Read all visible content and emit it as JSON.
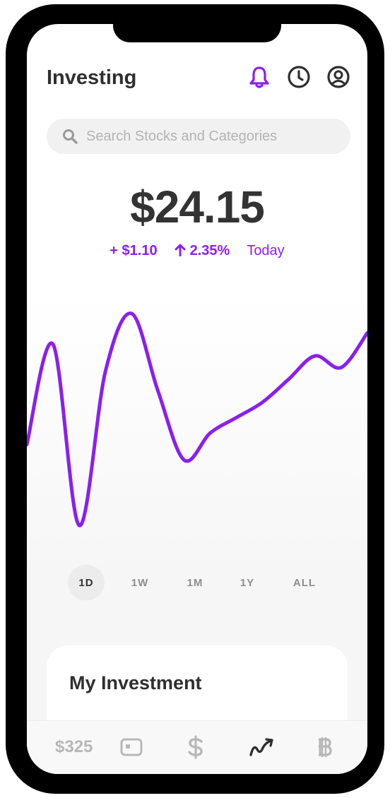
{
  "header": {
    "title": "Investing",
    "icons": [
      "bell-icon",
      "clock-icon",
      "profile-icon"
    ]
  },
  "search": {
    "placeholder": "Search Stocks and Categories"
  },
  "portfolio": {
    "value": "$24.15",
    "change_amount": "+ $1.10",
    "change_percent": "2.35%",
    "period": "Today"
  },
  "chart_data": {
    "type": "line",
    "title": "",
    "xlabel": "",
    "ylabel": "",
    "x": [
      0,
      1,
      2,
      3,
      4,
      5,
      6,
      7,
      8,
      9,
      10,
      11,
      12,
      13
    ],
    "y": [
      22.0,
      24.6,
      19.9,
      23.9,
      25.4,
      23.4,
      21.6,
      22.3,
      22.7,
      23.1,
      23.7,
      24.3,
      24.0,
      24.9
    ],
    "series_color": "#8a1ff0",
    "grid": false,
    "legend": "none"
  },
  "ranges": {
    "selected": "1D",
    "items": [
      {
        "label": "1D"
      },
      {
        "label": "1W"
      },
      {
        "label": "1M"
      },
      {
        "label": "1Y"
      },
      {
        "label": "ALL"
      }
    ]
  },
  "card": {
    "title": "My Investment"
  },
  "tabbar": {
    "balance": "$325",
    "items": [
      "card-icon",
      "dollar-icon",
      "investing-icon",
      "bitcoin-icon"
    ],
    "active": "investing-icon"
  },
  "colors": {
    "accent": "#8a1ff0",
    "text": "#2f2f2f",
    "muted": "#b8b8b8"
  }
}
